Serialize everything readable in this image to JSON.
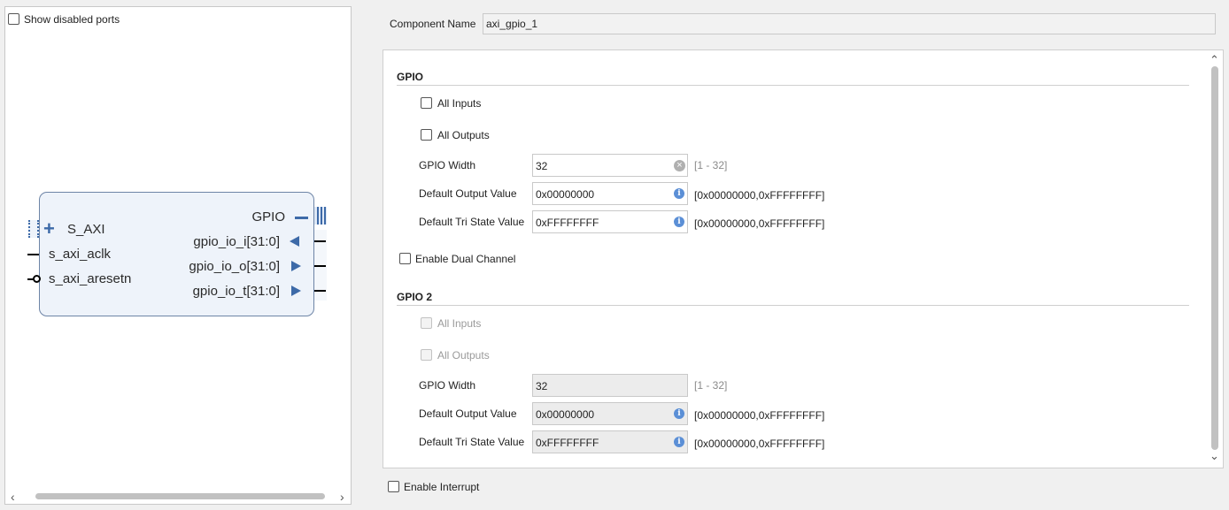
{
  "left_panel": {
    "show_disabled_ports_label": "Show disabled ports",
    "ip_block": {
      "left_ports": [
        "S_AXI",
        "s_axi_aclk",
        "s_axi_aresetn"
      ],
      "right_ports": [
        "GPIO",
        "gpio_io_i[31:0]",
        "gpio_io_o[31:0]",
        "gpio_io_t[31:0]"
      ],
      "plus": "+"
    },
    "scroll_left": "‹",
    "scroll_right": "›"
  },
  "component": {
    "label": "Component Name",
    "value": "axi_gpio_1"
  },
  "gpio": {
    "title": "GPIO",
    "all_inputs_label": "All Inputs",
    "all_outputs_label": "All Outputs",
    "width_label": "GPIO Width",
    "width_value": "32",
    "width_range": "[1 - 32]",
    "default_output_label": "Default Output Value",
    "default_output_value": "0x00000000",
    "default_output_range": "[0x00000000,0xFFFFFFFF]",
    "default_tri_label": "Default Tri State Value",
    "default_tri_value": "0xFFFFFFFF",
    "default_tri_range": "[0x00000000,0xFFFFFFFF]"
  },
  "dual_channel_label": "Enable Dual Channel",
  "gpio2": {
    "title": "GPIO 2",
    "all_inputs_label": "All Inputs",
    "all_outputs_label": "All Outputs",
    "width_label": "GPIO Width",
    "width_value": "32",
    "width_range": "[1 - 32]",
    "default_output_label": "Default Output Value",
    "default_output_value": "0x00000000",
    "default_output_range": "[0x00000000,0xFFFFFFFF]",
    "default_tri_label": "Default Tri State Value",
    "default_tri_value": "0xFFFFFFFF",
    "default_tri_range": "[0x00000000,0xFFFFFFFF]"
  },
  "enable_interrupt_label": "Enable Interrupt",
  "icons": {
    "info": "i",
    "clear": "×",
    "scroll_up": "⌃",
    "scroll_down": "⌄"
  }
}
